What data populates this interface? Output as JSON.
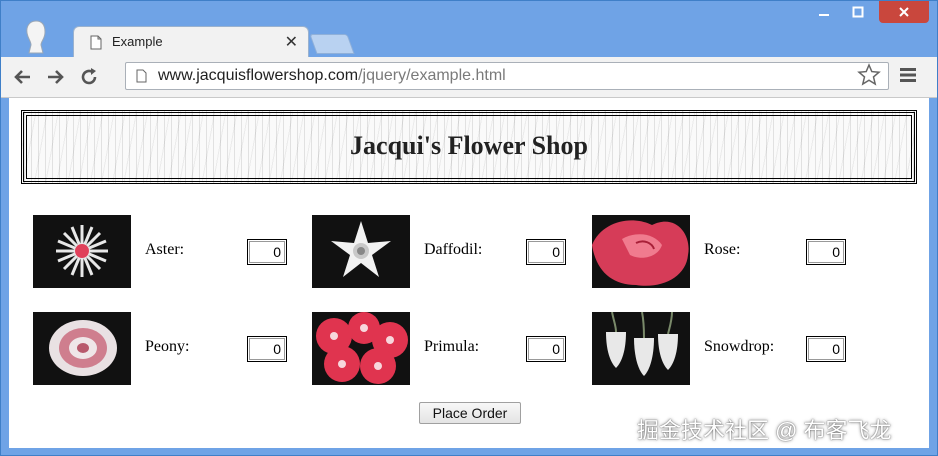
{
  "browser": {
    "tab_title": "Example",
    "url_host": "www.jacquisflowershop.com",
    "url_path": "/jquery/example.html",
    "window_controls": {
      "minimize_icon": "minimize-icon",
      "maximize_icon": "maximize-icon",
      "close_icon": "close-icon"
    }
  },
  "page": {
    "heading": "Jacqui's Flower Shop",
    "products": [
      {
        "label": "Aster:",
        "qty": "0",
        "color": "#e0405a"
      },
      {
        "label": "Daffodil:",
        "qty": "0",
        "color": "#f2f2f2"
      },
      {
        "label": "Rose:",
        "qty": "0",
        "color": "#d63c58"
      },
      {
        "label": "Peony:",
        "qty": "0",
        "color": "#cf7e8e"
      },
      {
        "label": "Primula:",
        "qty": "0",
        "color": "#e0344f"
      },
      {
        "label": "Snowdrop:",
        "qty": "0",
        "color": "#e8e8e8"
      }
    ],
    "order_button": "Place Order"
  },
  "watermark": "掘金技术社区 @ 布客飞龙"
}
